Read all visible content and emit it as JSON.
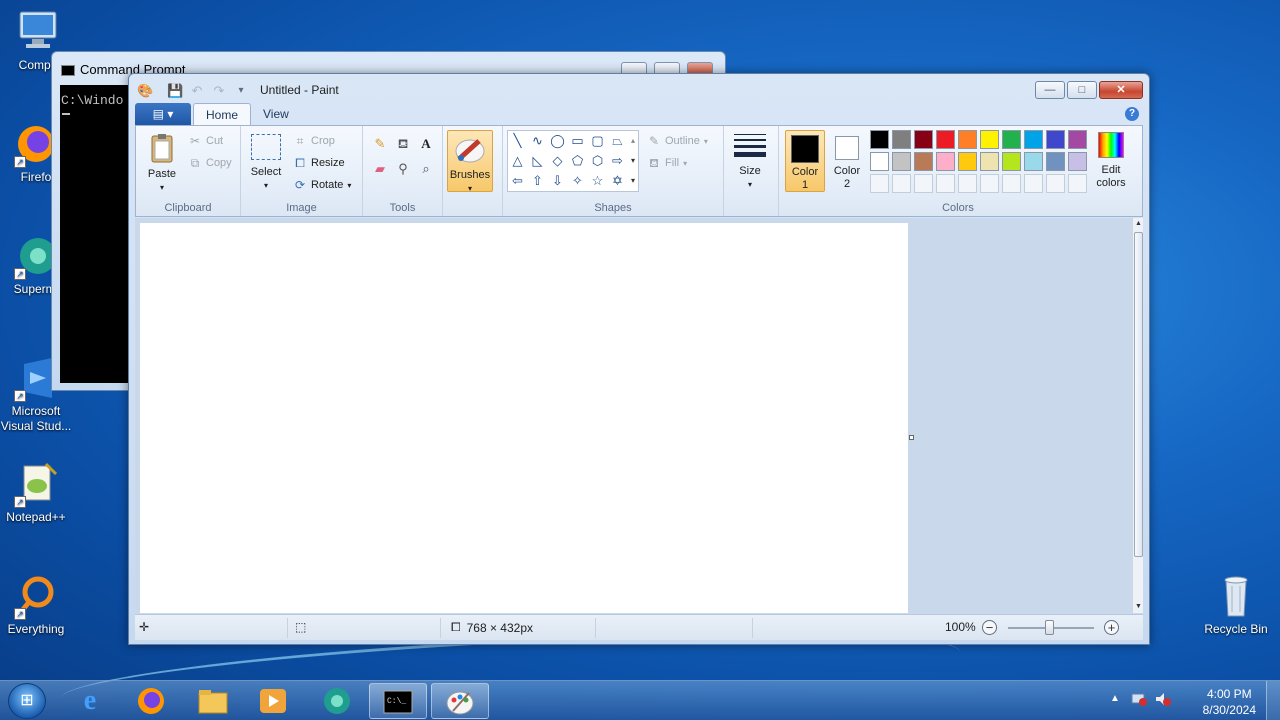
{
  "desktop": {
    "icons": [
      {
        "label": "Compu"
      },
      {
        "label": "Firefo"
      },
      {
        "label": "Supermi"
      },
      {
        "label": "Microsoft\nVisual Stud..."
      },
      {
        "label": "Notepad++"
      },
      {
        "label": "Everything"
      },
      {
        "label": "Recycle Bin"
      }
    ]
  },
  "cmd": {
    "title": "Command Prompt",
    "text": "C:\\Windo"
  },
  "paint": {
    "title": "Untitled - Paint",
    "tabs": {
      "file": "▤ ▾",
      "home": "Home",
      "view": "View"
    },
    "clipboard": {
      "paste": "Paste",
      "cut": "Cut",
      "copy": "Copy",
      "group": "Clipboard"
    },
    "image": {
      "select": "Select",
      "crop": "Crop",
      "resize": "Resize",
      "rotate": "Rotate",
      "group": "Image"
    },
    "tools": {
      "group": "Tools"
    },
    "brushes": {
      "label": "Brushes"
    },
    "shapes": {
      "outline": "Outline",
      "fill": "Fill",
      "group": "Shapes"
    },
    "size": {
      "label": "Size"
    },
    "colors": {
      "color1_line1": "Color",
      "color1_line2": "1",
      "color2_line1": "Color",
      "color2_line2": "2",
      "edit_line1": "Edit",
      "edit_line2": "colors",
      "group": "Colors",
      "color1": "#000000",
      "color2": "#ffffff",
      "row1": [
        "#000000",
        "#7f7f7f",
        "#880015",
        "#ed1c24",
        "#ff7f27",
        "#fff200",
        "#22b14c",
        "#00a2e8",
        "#3f48cc",
        "#a349a4"
      ],
      "row2": [
        "#ffffff",
        "#c3c3c3",
        "#b97a57",
        "#ffaec9",
        "#ffc90e",
        "#efe4b0",
        "#b5e61d",
        "#99d9ea",
        "#7092be",
        "#c8bfe7"
      ]
    },
    "status": {
      "dimensions": "768 × 432px",
      "zoom": "100%"
    }
  },
  "taskbar": {
    "time": "4:00 PM",
    "date": "8/30/2024"
  }
}
